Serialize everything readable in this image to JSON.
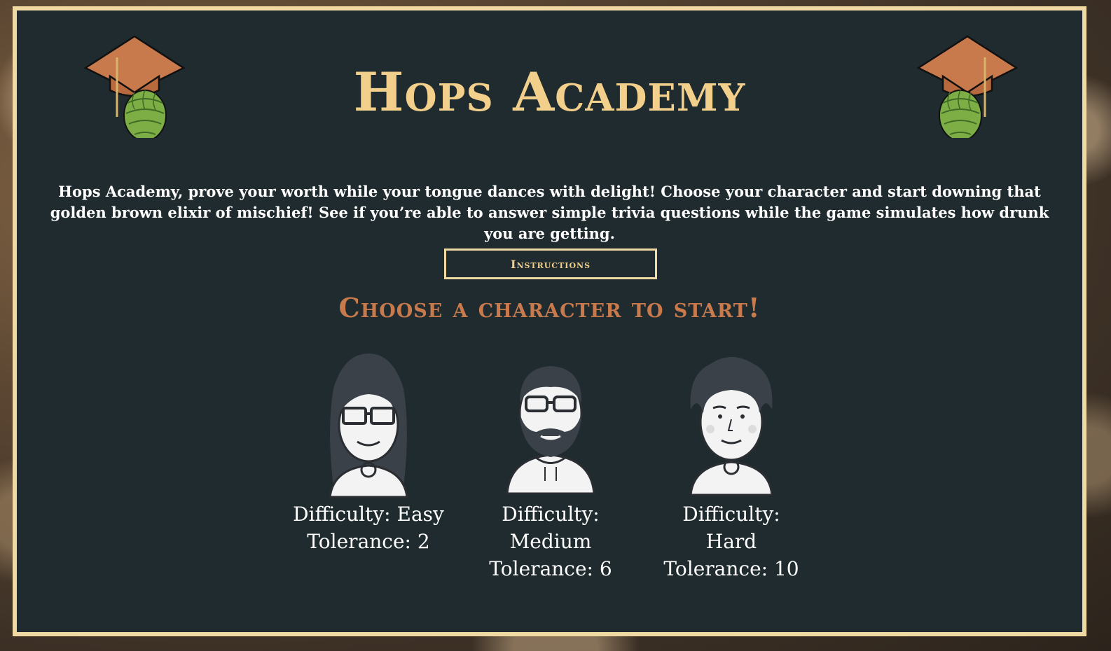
{
  "app": {
    "title": "Hops Academy",
    "description": "Hops Academy, prove your worth while your tongue dances with delight! Choose your character and start downing that golden brown elixir of mischief! See if you’re able to answer simple trivia questions while the game simulates how drunk you are getting."
  },
  "instructions_button": {
    "label": "Instructions"
  },
  "choose_heading": "Choose a character to start!",
  "characters": [
    {
      "difficulty": "Difficulty: Easy",
      "tolerance": "Tolerance: 2",
      "icon": "woman-glasses-avatar-icon"
    },
    {
      "difficulty": "Difficulty: Medium",
      "tolerance": "Tolerance: 6",
      "icon": "bearded-man-glasses-avatar-icon"
    },
    {
      "difficulty": "Difficulty: Hard",
      "tolerance": "Tolerance: 10",
      "icon": "curly-hair-man-avatar-icon"
    }
  ],
  "colors": {
    "panel_bg": "#1f2b2e",
    "border": "#f1d9a4",
    "title": "#f2cf8b",
    "heading_accent": "#c97a4c",
    "text": "#ffffff"
  },
  "decor": {
    "left_logo": "hop-graduation-cap-icon",
    "right_logo": "hop-graduation-cap-icon"
  }
}
